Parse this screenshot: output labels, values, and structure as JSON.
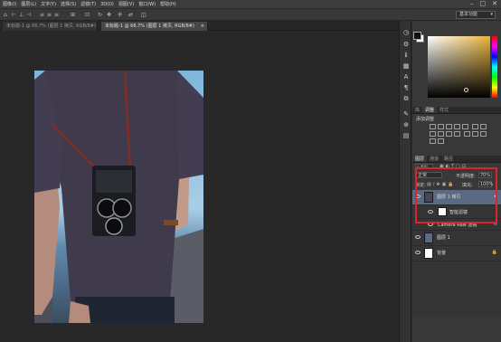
{
  "menu": {
    "items": [
      "图像(I)",
      "图层(L)",
      "文字(Y)",
      "选择(S)",
      "滤镜(T)",
      "3D(D)",
      "视图(V)",
      "窗口(W)",
      "帮助(H)"
    ],
    "window_controls": [
      "–",
      "□",
      "✕"
    ]
  },
  "options_bar": {
    "workspace": "基本功能"
  },
  "tabs": [
    {
      "label": "未标题-1 @ 66.7% (图层 1 拷贝, RGB/8#)",
      "active": false
    },
    {
      "label": "未标题-1 @ 66.7% (图层 1 拷贝, RGB/8#)",
      "active": true
    }
  ],
  "color_panel": {
    "foreground": "#111111",
    "background": "#ffffff",
    "picker_hue": "#e9b43a"
  },
  "adjustments_panel": {
    "tabs": [
      "库",
      "调整",
      "样式"
    ],
    "active_tab": "调整",
    "title": "添加调整"
  },
  "layers_panel": {
    "tabs": [
      "图层",
      "通道",
      "路径"
    ],
    "active_tab": "图层",
    "filter_kind": "ρ 类型",
    "blend_mode": "正常",
    "opacity_label": "不透明度:",
    "opacity_value": "70%",
    "lock_label": "锁定:",
    "fill_label": "填充:",
    "fill_value": "100%",
    "layers": [
      {
        "name": "图层 1 拷贝",
        "selected": true,
        "kind": "smart"
      },
      {
        "name": "智能滤镜",
        "selected": false,
        "kind": "filter-group"
      },
      {
        "name": "Camera Raw 滤镜",
        "selected": false,
        "kind": "filter"
      },
      {
        "name": "图层 1",
        "selected": false,
        "kind": "image"
      },
      {
        "name": "背景",
        "selected": false,
        "kind": "fill"
      }
    ]
  },
  "accent": {
    "highlight": "#e0222a",
    "selected_layer": "#5a6a82"
  }
}
